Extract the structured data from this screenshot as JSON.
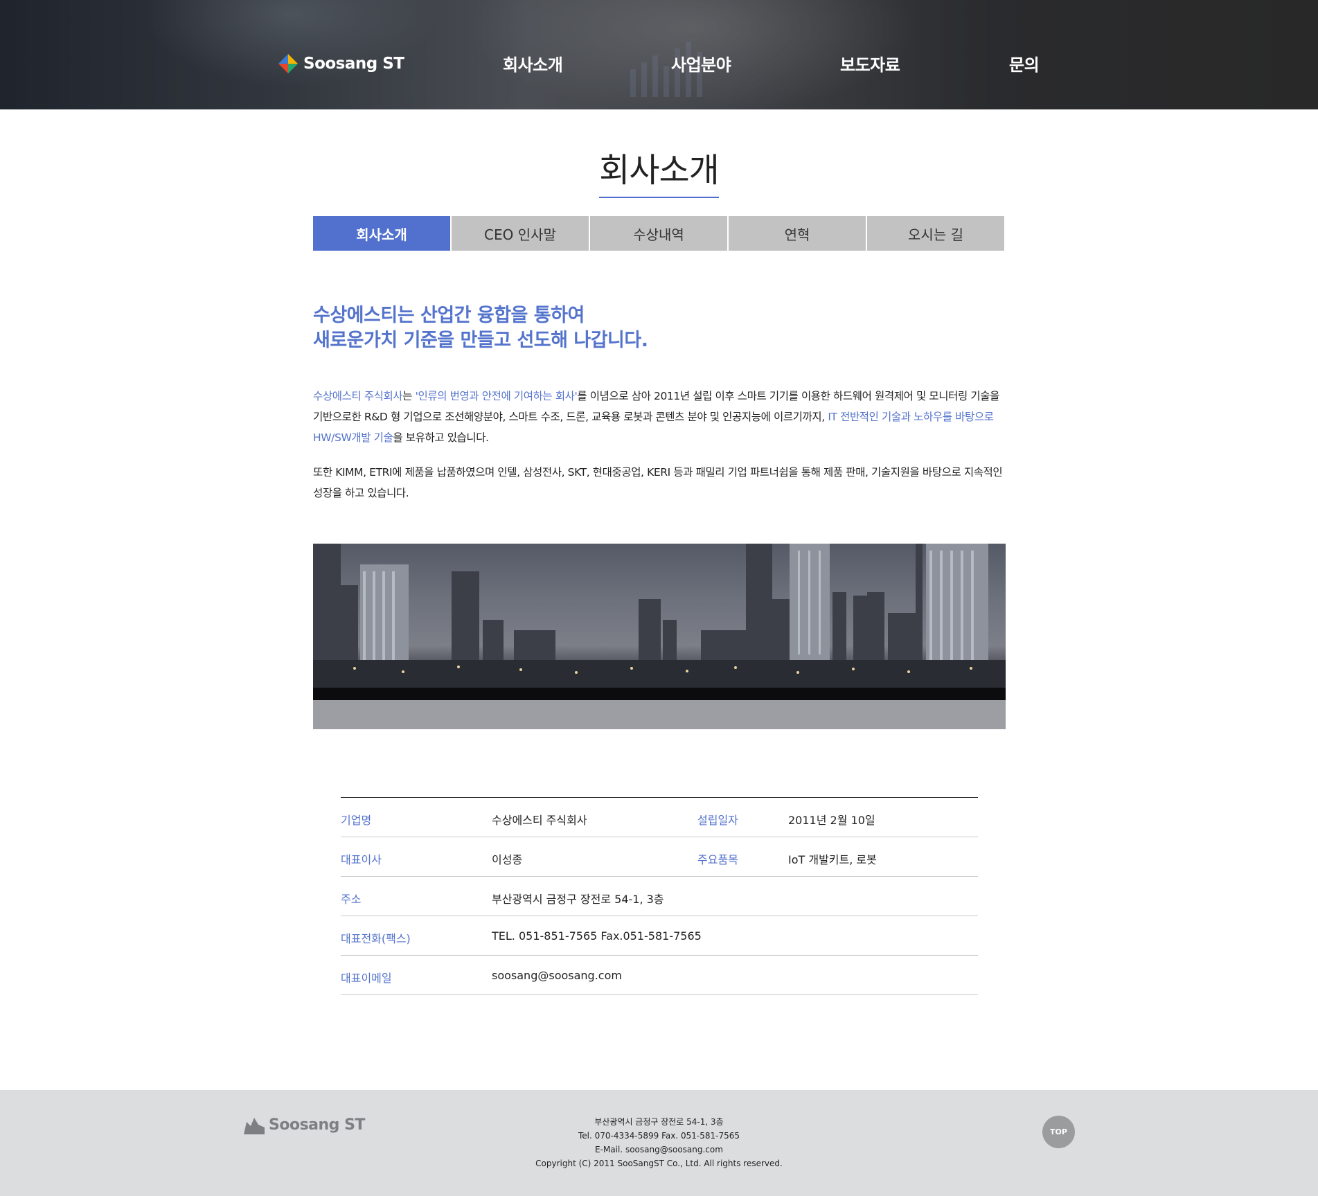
{
  "header": {
    "logo_text": "Soosang ST",
    "nav": [
      "회사소개",
      "사업분야",
      "보도자료",
      "문의"
    ]
  },
  "page_title": "회사소개",
  "tabs": [
    "회사소개",
    "CEO 인사말",
    "수상내역",
    "연혁",
    "오시는 길"
  ],
  "active_tab": 0,
  "headline": {
    "line1": "수상에스티는 산업간 융합을 통하여",
    "line2": "새로운가치 기준을 만들고 선도해 나갑니다."
  },
  "intro": {
    "company_hl": "수상에스티 주식회사",
    "t1": "는 ",
    "motto_hl": "'인류의 번영과 안전에 기여하는 회사'",
    "t2": "를 이념으로 삼아 2011년 설립 이후 스마트 기기를 이용한 하드웨어 원격제어 및 모니터링 기술을 기반으로한 R&D 형 기업으로 조선해양분야, 스마트 수조, 드론, 교육용 로봇과 콘텐츠 분야 및 인공지능에 이르기까지, ",
    "tech_hl": "IT 전반적인 기술과 노하우를 바탕으로 HW/SW개발 기술",
    "t3": "을 보유하고 있습니다."
  },
  "paragraph2": "또한 KIMM, ETRI에 제품을 납품하였으며 인텔, 삼성전사, SKT, 현대중공업, KERI 등과 패밀리 기업 파트너쉽을 통해 제품 판매, 기술지원을 바탕으로 지속적인 성장을 하고 있습니다.",
  "info": {
    "company_label": "기업명",
    "company_value": "수상에스티 주식회사",
    "founded_label": "설립일자",
    "founded_value": "2011년 2월 10일",
    "ceo_label": "대표이사",
    "ceo_value": "이성종",
    "products_label": "주요품목",
    "products_value": "IoT 개발키트, 로봇",
    "address_label": "주소",
    "address_value": "부산광역시 금정구 장전로 54-1, 3층",
    "phone_label": "대표전화(팩스)",
    "phone_value": "TEL. 051-851-7565 Fax.051-581-7565",
    "email_label": "대표이메일",
    "email_value": "soosang@soosang.com"
  },
  "footer": {
    "logo_text": "Soosang ST",
    "address": "부산광역시 금정구 장전로 54-1, 3층",
    "tel_fax": "Tel. 070-4334-5899   Fax. 051-581-7565",
    "email": "E-Mail. soosang@soosang.com",
    "copyright": "Copyright (C) 2011 SooSangST Co., Ltd. All rights reserved.",
    "top_button": "TOP"
  },
  "colors": {
    "accent": "#5271cf",
    "tab_inactive": "#c2c2c2",
    "footer_bg": "#dcdddf"
  }
}
